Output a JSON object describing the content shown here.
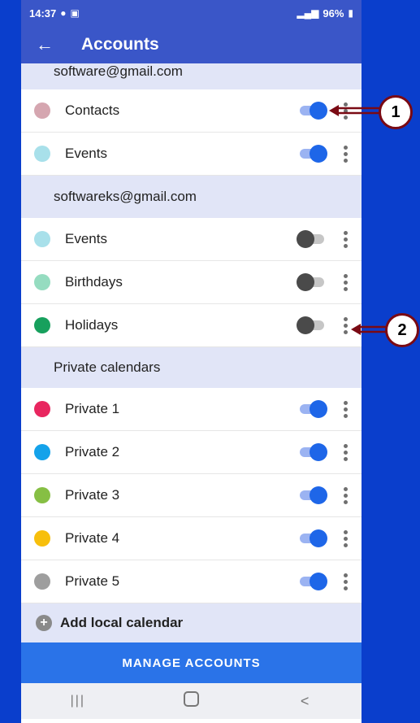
{
  "status": {
    "time": "14:37",
    "battery": "96%"
  },
  "appbar": {
    "title": "Accounts"
  },
  "sections": [
    {
      "title": "software@gmail.com",
      "rows": [
        {
          "label": "Contacts",
          "color": "#d5a6b0",
          "on": true
        },
        {
          "label": "Events",
          "color": "#a8e0ea",
          "on": true
        }
      ]
    },
    {
      "title": "softwareks@gmail.com",
      "rows": [
        {
          "label": "Events",
          "color": "#a8e0ea",
          "on": false
        },
        {
          "label": "Birthdays",
          "color": "#95dcc0",
          "on": false
        },
        {
          "label": "Holidays",
          "color": "#17a05d",
          "on": false
        }
      ]
    },
    {
      "title": "Private calendars",
      "rows": [
        {
          "label": "Private 1",
          "color": "#e8265f",
          "on": true
        },
        {
          "label": "Private 2",
          "color": "#14a2ea",
          "on": true
        },
        {
          "label": "Private 3",
          "color": "#86bf44",
          "on": true
        },
        {
          "label": "Private 4",
          "color": "#f7bf0c",
          "on": true
        },
        {
          "label": "Private 5",
          "color": "#9e9e9e",
          "on": true
        }
      ]
    }
  ],
  "add_local": "Add local calendar",
  "manage": "MANAGE ACCOUNTS",
  "callouts": [
    "1",
    "2"
  ]
}
